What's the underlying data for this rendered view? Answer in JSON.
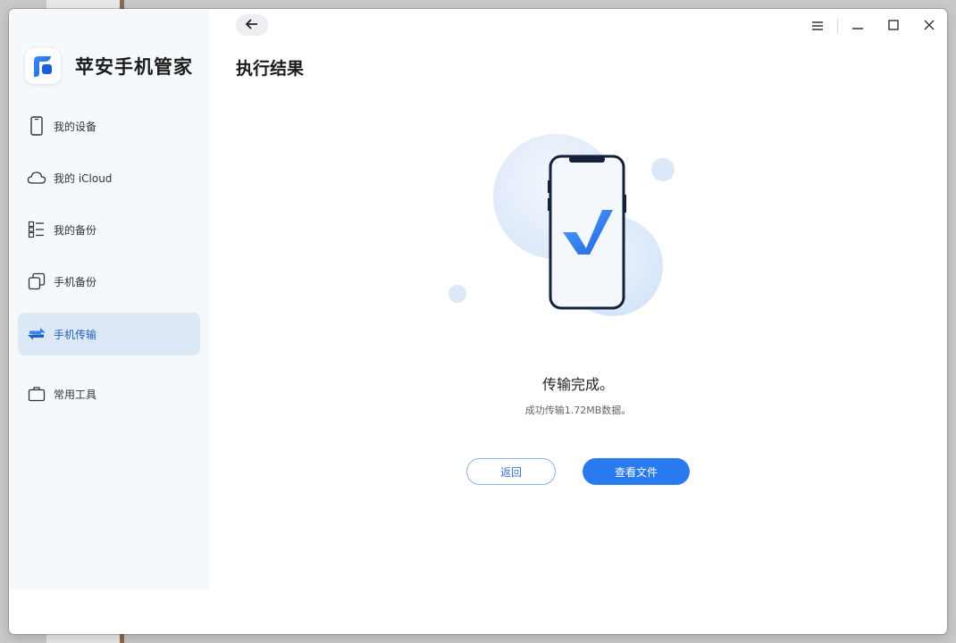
{
  "app": {
    "name": "苹安手机管家"
  },
  "sidebar": {
    "items": [
      {
        "label": "我的设备",
        "icon": "phone-icon",
        "active": false
      },
      {
        "label": "我的 iCloud",
        "icon": "cloud-icon",
        "active": false
      },
      {
        "label": "我的备份",
        "icon": "list-icon",
        "active": false
      },
      {
        "label": "手机备份",
        "icon": "copy-icon",
        "active": false
      },
      {
        "label": "手机传输",
        "icon": "transfer-icon",
        "active": true
      },
      {
        "label": "常用工具",
        "icon": "toolbox-icon",
        "active": false
      }
    ]
  },
  "header": {
    "title": "执行结果"
  },
  "result": {
    "title": "传输完成。",
    "subtitle": "成功传输1.72MB数据。"
  },
  "buttons": {
    "return_label": "返回",
    "view_files_label": "查看文件"
  },
  "colors": {
    "accent": "#2b7bf0",
    "active_nav_bg": "#dde8f7",
    "sidebar_bg": "#f6f9fc"
  }
}
